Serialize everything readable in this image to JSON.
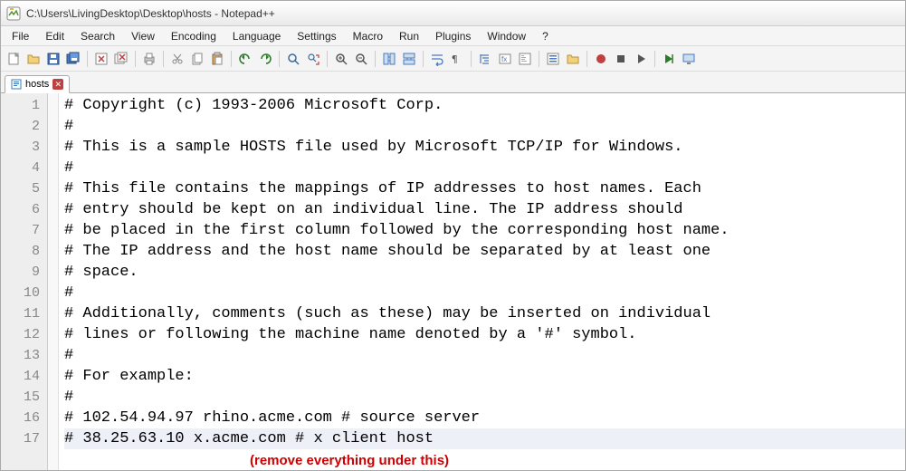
{
  "window": {
    "title": "C:\\Users\\LivingDesktop\\Desktop\\hosts - Notepad++"
  },
  "menus": [
    "File",
    "Edit",
    "Search",
    "View",
    "Encoding",
    "Language",
    "Settings",
    "Macro",
    "Run",
    "Plugins",
    "Window",
    "?"
  ],
  "tab": {
    "label": "hosts"
  },
  "lines": [
    "# Copyright (c) 1993-2006 Microsoft Corp.",
    "#",
    "# This is a sample HOSTS file used by Microsoft TCP/IP for Windows.",
    "#",
    "# This file contains the mappings of IP addresses to host names. Each",
    "# entry should be kept on an individual line. The IP address should",
    "# be placed in the first column followed by the corresponding host name.",
    "# The IP address and the host name should be separated by at least one",
    "# space.",
    "#",
    "# Additionally, comments (such as these) may be inserted on individual",
    "# lines or following the machine name denoted by a '#' symbol.",
    "#",
    "# For example:",
    "#",
    "# 102.54.94.97 rhino.acme.com # source server",
    "# 38.25.63.10 x.acme.com # x client host"
  ],
  "annotation": "(remove everything under this)",
  "toolbar_icons": [
    "new-file-icon",
    "open-file-icon",
    "save-icon",
    "save-all-icon",
    "sep",
    "close-icon",
    "close-all-icon",
    "sep",
    "print-icon",
    "sep",
    "cut-icon",
    "copy-icon",
    "paste-icon",
    "sep",
    "undo-icon",
    "redo-icon",
    "sep",
    "find-icon",
    "replace-icon",
    "sep",
    "zoom-in-icon",
    "zoom-out-icon",
    "sep",
    "sync-v-icon",
    "sync-h-icon",
    "sep",
    "wordwrap-icon",
    "show-all-chars-icon",
    "sep",
    "indent-guide-icon",
    "lang-icon",
    "doc-map-icon",
    "sep",
    "func-list-icon",
    "folder-icon",
    "sep",
    "record-macro-icon",
    "stop-macro-icon",
    "play-macro-icon",
    "sep",
    "run-icon",
    "monitor-icon"
  ]
}
